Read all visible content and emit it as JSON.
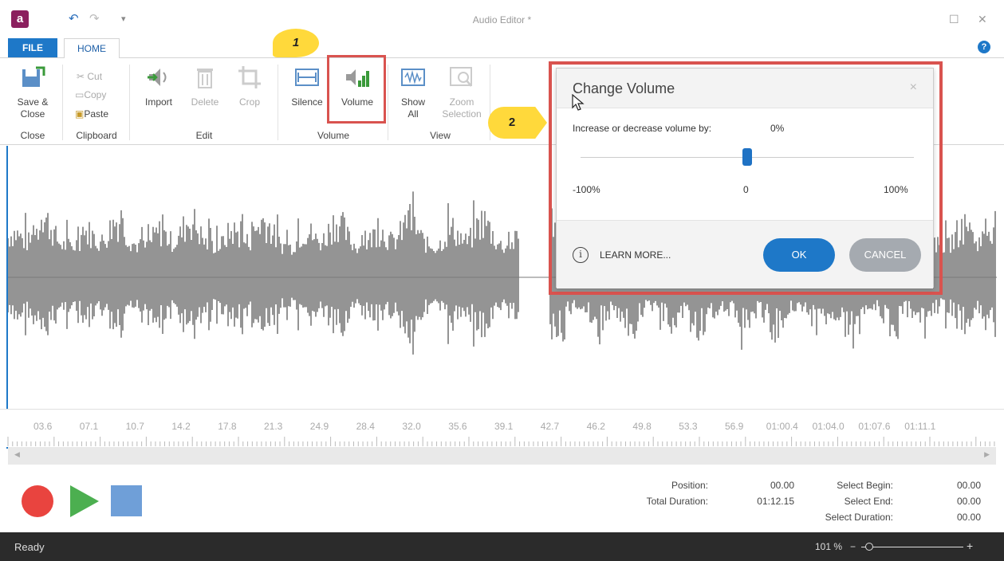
{
  "window": {
    "title": "Audio Editor *",
    "app_icon": "a"
  },
  "tabs": {
    "file": "FILE",
    "home": "HOME"
  },
  "ribbon": {
    "close_group": {
      "save_close": "Save &\nClose",
      "label": "Close"
    },
    "clipboard": {
      "cut": "Cut",
      "copy": "Copy",
      "paste": "Paste",
      "label": "Clipboard"
    },
    "edit": {
      "import": "Import",
      "delete": "Delete",
      "crop": "Crop",
      "label": "Edit"
    },
    "volume": {
      "silence": "Silence",
      "volume": "Volume",
      "label": "Volume"
    },
    "view": {
      "show_all": "Show\nAll",
      "zoom_selection": "Zoom\nSelection",
      "label": "View"
    }
  },
  "callouts": {
    "one": "1",
    "two": "2"
  },
  "ruler": {
    "ticks": [
      "03.6",
      "07.1",
      "10.7",
      "14.2",
      "17.8",
      "21.3",
      "24.9",
      "28.4",
      "32.0",
      "35.6",
      "39.1",
      "42.7",
      "46.2",
      "49.8",
      "53.3",
      "56.9",
      "01:00.4",
      "01:04.0",
      "01:07.6",
      "01:11.1"
    ]
  },
  "transport": {
    "position_label": "Position:",
    "position_value": "00.00",
    "total_label": "Total Duration:",
    "total_value": "01:12.15",
    "sel_begin_label": "Select Begin:",
    "sel_begin_value": "00.00",
    "sel_end_label": "Select End:",
    "sel_end_value": "00.00",
    "sel_dur_label": "Select Duration:",
    "sel_dur_value": "00.00"
  },
  "status": {
    "text": "Ready",
    "zoom": "101 %",
    "minus": "−",
    "plus": "+"
  },
  "dialog": {
    "title": "Change Volume",
    "close": "×",
    "prompt": "Increase or decrease volume by:",
    "value": "0%",
    "volume_level": 0,
    "min": "-100%",
    "mid": "0",
    "max": "100%",
    "info": "i",
    "learn_more": "LEARN MORE...",
    "ok": "OK",
    "cancel": "CANCEL"
  },
  "colors": {
    "accent": "#1e78c8",
    "highlight": "#d9534f",
    "callout": "#ffd93b",
    "waveform": "#7a7a7a"
  }
}
